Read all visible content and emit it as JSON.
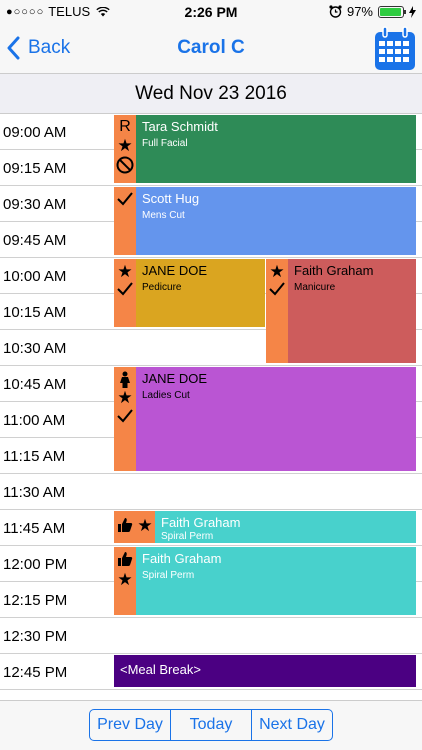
{
  "status_bar": {
    "carrier": "TELUS",
    "time": "2:26 PM",
    "battery": "97%",
    "battery_level": 0.97,
    "signal_dots": "●○○○○"
  },
  "nav": {
    "back_label": "Back",
    "title": "Carol C",
    "back_icon": "chevron-left-icon",
    "calendar_icon": "calendar-icon",
    "accent_color": "#1a73e8"
  },
  "date_header": "Wed Nov 23 2016",
  "time_slots": [
    "09:00 AM",
    "09:15 AM",
    "09:30 AM",
    "09:45 AM",
    "10:00 AM",
    "10:15 AM",
    "10:30 AM",
    "10:45 AM",
    "11:00 AM",
    "11:15 AM",
    "11:30 AM",
    "11:45 AM",
    "12:00 PM",
    "12:15 PM",
    "12:30 PM",
    "12:45 PM"
  ],
  "appointments": [
    {
      "client": "Tara Schmidt",
      "service": "Full Facial",
      "color": "#2e8b57",
      "text_color": "#ffffff",
      "icons": [
        "R",
        "star-icon",
        "no-show-icon"
      ]
    },
    {
      "client": "Scott Hug",
      "service": "Mens Cut",
      "color": "#6495ed",
      "text_color": "#ffffff",
      "icons": [
        "checkmark-icon"
      ]
    },
    {
      "client": "JANE DOE",
      "service": "Pedicure",
      "color": "#daa520",
      "text_color": "#000000",
      "icons": [
        "star-icon",
        "checkmark-icon"
      ]
    },
    {
      "client": "Faith Graham",
      "service": "Manicure",
      "color": "#cd5c5c",
      "text_color": "#000000",
      "icons": [
        "star-icon",
        "checkmark-icon"
      ]
    },
    {
      "client": "JANE DOE",
      "service": "Ladies Cut",
      "color": "#ba55d3",
      "text_color": "#000000",
      "icons": [
        "female-icon",
        "star-icon",
        "checkmark-icon"
      ]
    },
    {
      "client": "Faith Graham",
      "service": "Spiral Perm",
      "color": "#48d1cc",
      "text_color": "#ffffff",
      "icons": [
        "thumbs-up-icon",
        "star-icon"
      ]
    },
    {
      "client": "Faith Graham",
      "service": "Spiral Perm",
      "color": "#48d1cc",
      "text_color": "#ffffff",
      "icons": [
        "thumbs-up-icon",
        "star-icon"
      ]
    },
    {
      "client": "<Meal Break>",
      "service": "",
      "color": "#4b0082",
      "text_color": "#ffffff",
      "icons": []
    }
  ],
  "icon_strip_color": "#f58547",
  "footer": {
    "prev_label": "Prev Day",
    "today_label": "Today",
    "next_label": "Next Day"
  }
}
